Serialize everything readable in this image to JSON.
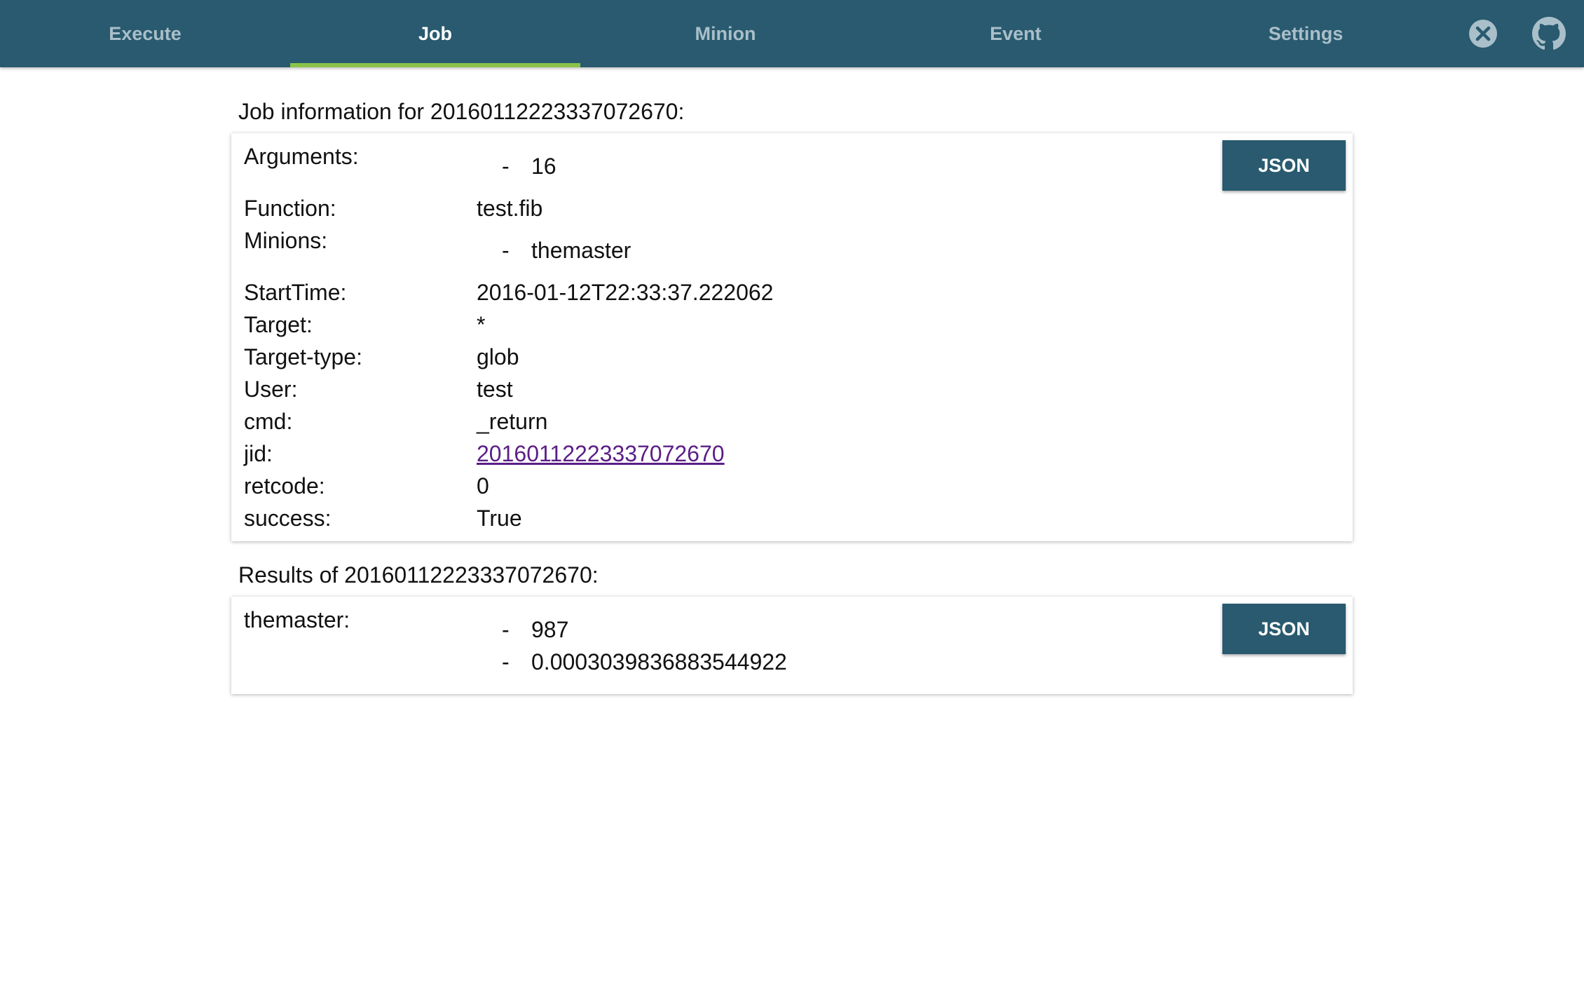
{
  "nav": {
    "tabs": [
      {
        "label": "Execute",
        "active": false
      },
      {
        "label": "Job",
        "active": true
      },
      {
        "label": "Minion",
        "active": false
      },
      {
        "label": "Event",
        "active": false
      },
      {
        "label": "Settings",
        "active": false
      }
    ],
    "icons": [
      "close-circle-icon",
      "github-icon"
    ],
    "colors": {
      "bar": "#295a6f",
      "active_underline": "#8bc34a",
      "inactive_text": "#a9bfc9"
    }
  },
  "job_info": {
    "title": "Job information for 20160112223337072670:",
    "json_button": "JSON",
    "arguments": {
      "label": "Arguments:",
      "items": [
        "16"
      ]
    },
    "function": {
      "label": "Function:",
      "value": "test.fib"
    },
    "minions": {
      "label": "Minions:",
      "items": [
        "themaster"
      ]
    },
    "start_time": {
      "label": "StartTime:",
      "value": "2016-01-12T22:33:37.222062"
    },
    "target": {
      "label": "Target:",
      "value": "*"
    },
    "target_type": {
      "label": "Target-type:",
      "value": "glob"
    },
    "user": {
      "label": "User:",
      "value": "test"
    },
    "cmd": {
      "label": "cmd:",
      "value": "_return"
    },
    "jid": {
      "label": "jid:",
      "value": "20160112223337072670"
    },
    "retcode": {
      "label": "retcode:",
      "value": "0"
    },
    "success": {
      "label": "success:",
      "value": "True"
    }
  },
  "results": {
    "title": "Results of 20160112223337072670:",
    "json_button": "JSON",
    "minion": {
      "label": "themaster:",
      "items": [
        "987",
        "0.0003039836883544922"
      ]
    }
  },
  "list_dash": "-"
}
